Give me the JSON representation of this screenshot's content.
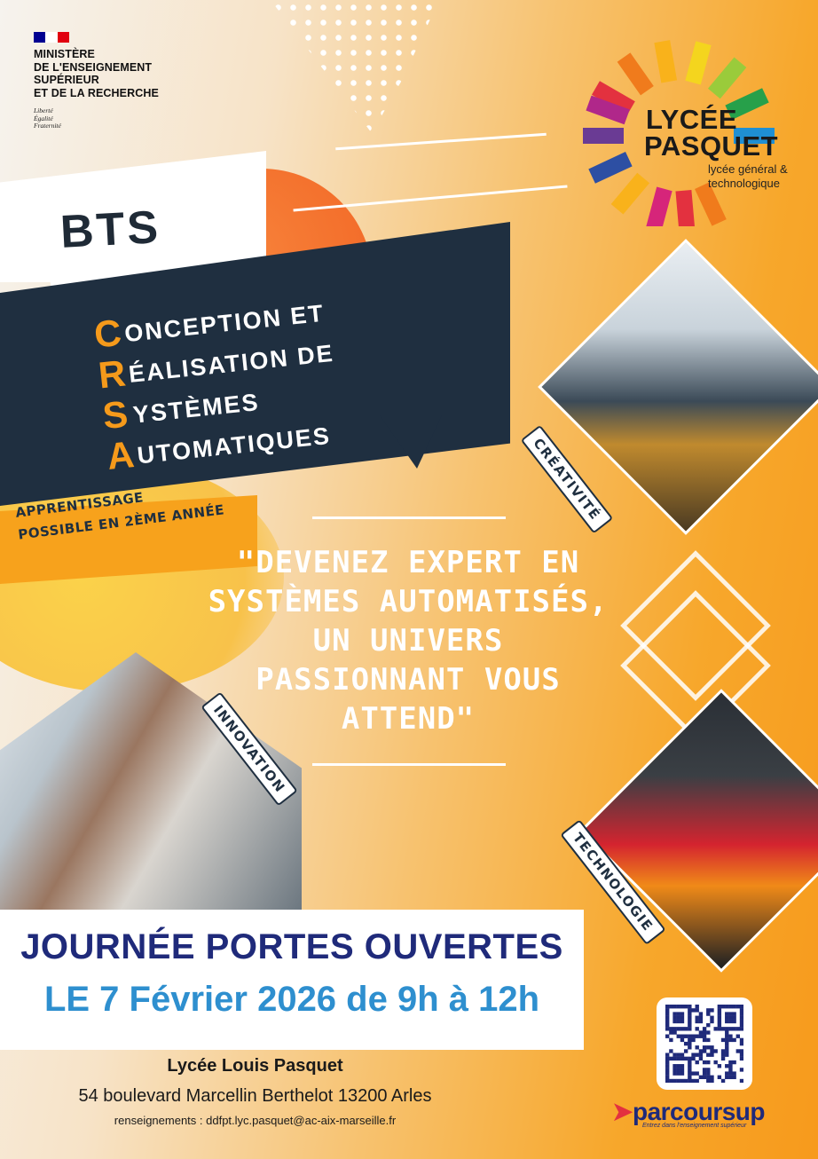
{
  "ministry": {
    "lines": [
      "MINISTÈRE",
      "DE L'ENSEIGNEMENT",
      "SUPÉRIEUR",
      "ET DE LA RECHERCHE"
    ],
    "motto": [
      "Liberté",
      "Égalité",
      "Fraternité"
    ],
    "flag_colors": [
      "#000091",
      "#ffffff",
      "#e1000f"
    ]
  },
  "lycee_logo": {
    "name_line1": "LYCÉE",
    "name_line2": "PASQUET",
    "subtitle_line1": "lycée général &",
    "subtitle_line2": "technologique",
    "ray_colors": [
      "#e3313f",
      "#f07b1c",
      "#f9b21b",
      "#f4d51e",
      "#9acb3b",
      "#27a04a",
      "#1f8fd3",
      "#2d4fa3",
      "#6a3b94",
      "#b0278a",
      "#d6257a"
    ]
  },
  "bts": "BTS",
  "program": [
    {
      "letter": "C",
      "rest": "ONCEPTION ET"
    },
    {
      "letter": "R",
      "rest": "ÉALISATION DE"
    },
    {
      "letter": "S",
      "rest": "YSTÈMES"
    },
    {
      "letter": "A",
      "rest": "UTOMATIQUES"
    }
  ],
  "apprenticeship": {
    "line1": "APPRENTISSAGE",
    "line2": "POSSIBLE EN 2ÈME ANNÉE"
  },
  "quote": {
    "line1": "\"DEVENEZ EXPERT EN",
    "line2": "SYSTÈMES AUTOMATISÉS,",
    "line3": "UN UNIVERS",
    "line4": "PASSIONNANT VOUS",
    "line5": "ATTEND\""
  },
  "tags": {
    "creativite": "CRÉATIVITÉ",
    "innovation": "INNOVATION",
    "technologie": "TECHNOLOGIE"
  },
  "event": {
    "title": "JOURNÉE PORTES OUVERTES",
    "date": "LE 7 Février 2026 de 9h à 12h"
  },
  "address": {
    "name": "Lycée Louis Pasquet",
    "street": "54 boulevard Marcellin Berthelot 13200 Arles",
    "contact": "renseignements : ddfpt.lyc.pasquet@ac-aix-marseille.fr"
  },
  "parcoursup": {
    "logo_text": "parcoursup",
    "tagline": "Entrez dans l'enseignement supérieur"
  },
  "colors": {
    "navy": "#1f2f40",
    "orange": "#f59a1b",
    "blue_title": "#1f2a7a",
    "blue_date": "#2e8fcf"
  }
}
